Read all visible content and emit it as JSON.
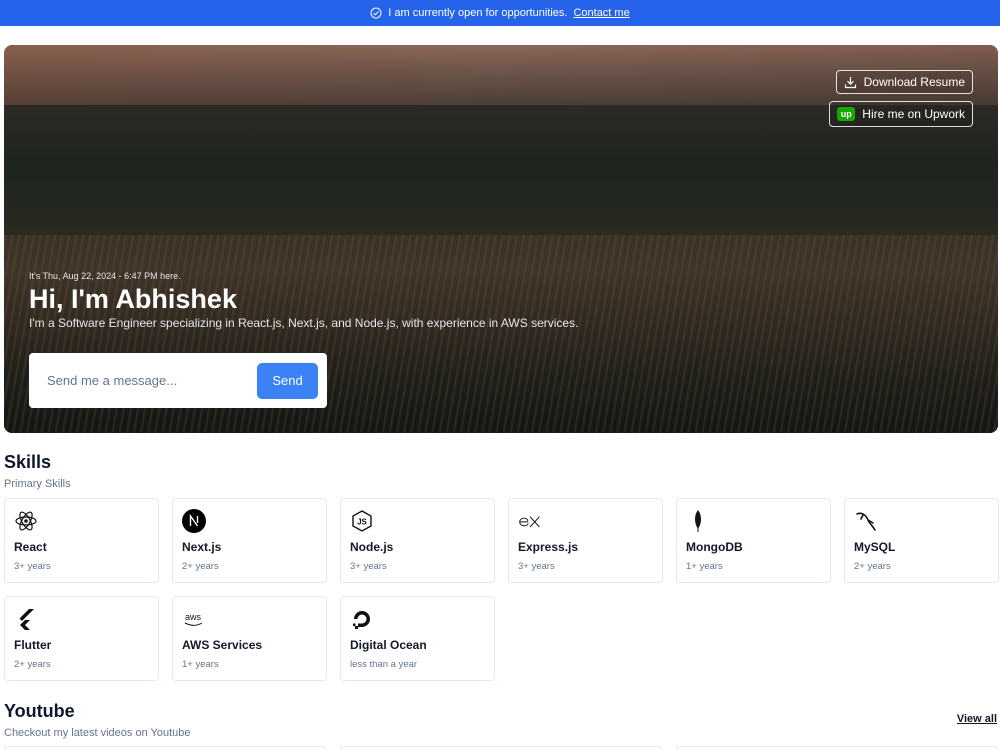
{
  "banner": {
    "text": "I am currently open for opportunities.",
    "link": "Contact me"
  },
  "hero": {
    "download_label": "Download Resume",
    "upwork_logo": "up",
    "upwork_label": "Hire me on Upwork",
    "date_text": "It's Thu, Aug 22, 2024 - 6:47 PM here.",
    "title": "Hi, I'm Abhishek",
    "subtitle": "I'm a Software Engineer specializing in React.js, Next.js, and Node.js, with experience in AWS services.",
    "message_placeholder": "Send me a message...",
    "send_label": "Send"
  },
  "skills": {
    "title": "Skills",
    "subtitle": "Primary Skills",
    "items": [
      {
        "name": "React",
        "years": "3+ years",
        "icon": "react-icon"
      },
      {
        "name": "Next.js",
        "years": "2+ years",
        "icon": "nextjs-icon"
      },
      {
        "name": "Node.js",
        "years": "3+ years",
        "icon": "nodejs-icon"
      },
      {
        "name": "Express.js",
        "years": "3+ years",
        "icon": "express-icon"
      },
      {
        "name": "MongoDB",
        "years": "1+ years",
        "icon": "mongodb-icon"
      },
      {
        "name": "MySQL",
        "years": "2+ years",
        "icon": "mysql-icon"
      },
      {
        "name": "Flutter",
        "years": "2+ years",
        "icon": "flutter-icon"
      },
      {
        "name": "AWS Services",
        "years": "1+ years",
        "icon": "aws-icon"
      },
      {
        "name": "Digital Ocean",
        "years": "less than a year",
        "icon": "digitalocean-icon"
      }
    ]
  },
  "youtube": {
    "title": "Youtube",
    "subtitle": "Checkout my latest videos on Youtube",
    "view_all": "View all"
  },
  "colors": {
    "banner": "#2563eb",
    "send_button": "#3b82f6",
    "upwork": "#14a800"
  }
}
